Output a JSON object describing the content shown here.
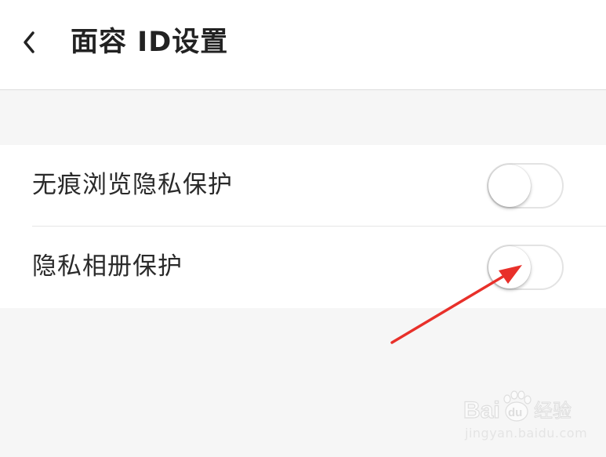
{
  "header": {
    "title": "面容 ID设置",
    "back_icon": "chevron-left-icon"
  },
  "settings": [
    {
      "label": "无痕浏览隐私保护",
      "toggle_on": false
    },
    {
      "label": "隐私相册保护",
      "toggle_on": false
    }
  ],
  "annotation": {
    "arrow_color": "#e8302a"
  },
  "watermark": {
    "brand": "Baidu经验",
    "url": "jingyan.baidu.com"
  },
  "colors": {
    "background": "#f6f6f6",
    "surface": "#ffffff",
    "text": "#222222",
    "toggle_off_border": "#e3e3e3"
  }
}
